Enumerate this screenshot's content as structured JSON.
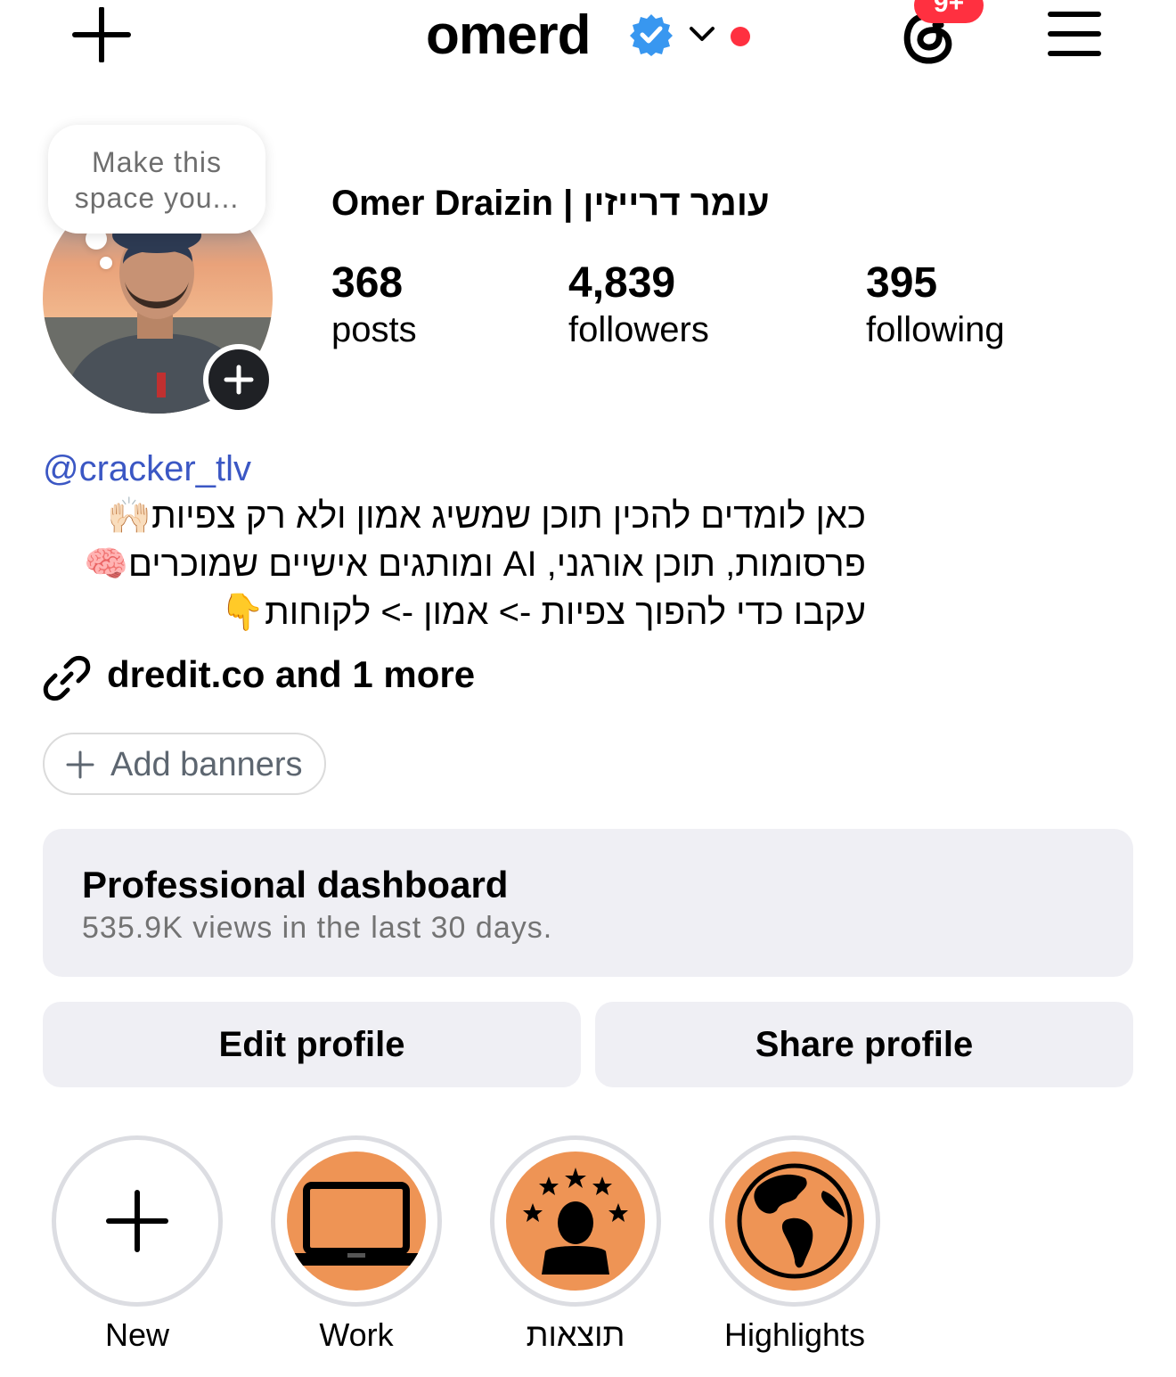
{
  "header": {
    "username": "omerd",
    "notification_badge": "9+",
    "icons": [
      "plus-icon",
      "verified-badge-icon",
      "chevron-down-icon",
      "threads-icon",
      "menu-icon"
    ],
    "colors": {
      "verified": "#3897f0",
      "badge": "#ff3040"
    }
  },
  "profile": {
    "note": "Make this space you...",
    "full_name": "Omer Draizin | עומר דרייזין",
    "stats": [
      {
        "value": "368",
        "label": "posts"
      },
      {
        "value": "4,839",
        "label": "followers"
      },
      {
        "value": "395",
        "label": "following"
      }
    ]
  },
  "bio": {
    "handle": "@cracker_tlv",
    "lines": [
      {
        "text": "כאן לומדים להכין תוכן שמשיג אמון ולא רק צפיות",
        "emoji": "🙌🏻"
      },
      {
        "text": "פרסומות, תוכן אורגני, AI ומותגים אישיים שמוכרים",
        "emoji": "🧠"
      },
      {
        "text": "עקבו כדי להפוך צפיות -> אמון -> לקוחות",
        "emoji": "👇"
      }
    ],
    "links": "dredit.co and 1 more"
  },
  "add_banners": "Add banners",
  "dashboard": {
    "title": "Professional dashboard",
    "subtitle": "535.9K views in the last 30 days."
  },
  "actions": {
    "edit": "Edit profile",
    "share": "Share profile"
  },
  "highlights": [
    {
      "label": "New",
      "icon": "plus-icon"
    },
    {
      "label": "Work",
      "icon": "laptop-icon"
    },
    {
      "label": "תוצאות",
      "icon": "person-stars-icon"
    },
    {
      "label": "Highlights",
      "icon": "globe-icon"
    }
  ],
  "highlight_color": "#ee9455"
}
